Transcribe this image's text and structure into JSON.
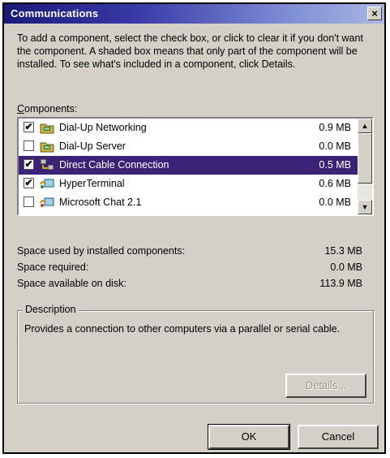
{
  "window": {
    "title": "Communications",
    "close_glyph": "×"
  },
  "intro_text": "To add a component, select the check box, or click to clear it if you don't want the component. A shaded box means that only part of the component will be installed. To see what's included in a component, click Details.",
  "components": {
    "label_underlined": "C",
    "label_rest": "omponents:",
    "items": [
      {
        "name": "Dial-Up Networking",
        "size": "0.9 MB",
        "checked": true,
        "selected": false,
        "icon": "folder-network-icon"
      },
      {
        "name": "Dial-Up Server",
        "size": "0.0 MB",
        "checked": false,
        "selected": false,
        "icon": "folder-network-icon"
      },
      {
        "name": "Direct Cable Connection",
        "size": "0.5 MB",
        "checked": true,
        "selected": true,
        "icon": "computers-link-icon"
      },
      {
        "name": "HyperTerminal",
        "size": "0.6 MB",
        "checked": true,
        "selected": false,
        "icon": "phone-terminal-icon"
      },
      {
        "name": "Microsoft Chat 2.1",
        "size": "0.0 MB",
        "checked": false,
        "selected": false,
        "icon": "chat-icon"
      }
    ],
    "scroll_up_glyph": "▲",
    "scroll_down_glyph": "▼"
  },
  "space": {
    "used_label": "Space used by installed components:",
    "used_value": "15.3 MB",
    "required_label": "Space required:",
    "required_value": "0.0 MB",
    "available_label": "Space available on disk:",
    "available_value": "113.9 MB"
  },
  "description": {
    "legend": "Description",
    "text": "Provides a connection to other computers via a parallel or serial cable."
  },
  "buttons": {
    "details": "Details...",
    "ok": "OK",
    "cancel": "Cancel"
  },
  "colors": {
    "selection": "#3b2277",
    "dialog_face": "#d4d0c8"
  }
}
